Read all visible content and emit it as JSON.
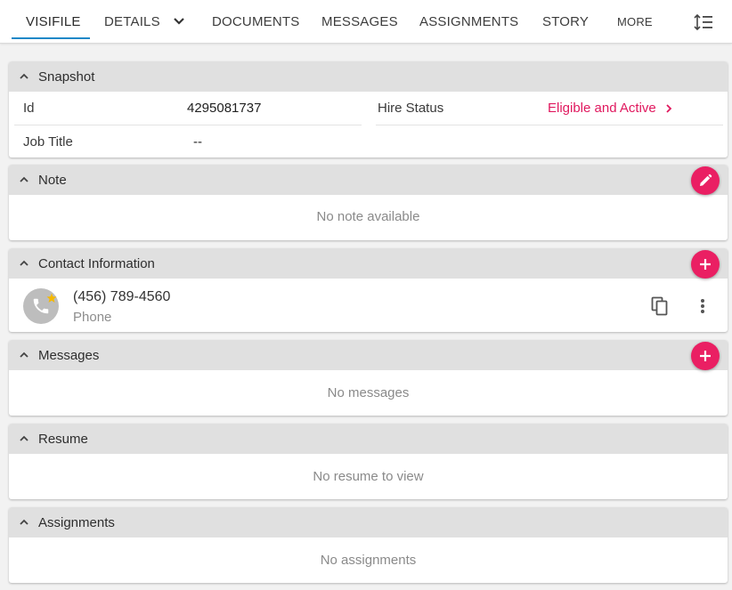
{
  "nav": {
    "tabs": [
      {
        "label": "VISIFILE"
      },
      {
        "label": "DETAILS"
      },
      {
        "label": "DOCUMENTS"
      },
      {
        "label": "MESSAGES"
      },
      {
        "label": "ASSIGNMENTS"
      },
      {
        "label": "STORY"
      },
      {
        "label": "MORE"
      }
    ],
    "active_tab": "VISIFILE",
    "sort_icon": "line-height-sort-icon"
  },
  "sections": {
    "snapshot": {
      "title": "Snapshot",
      "fields": {
        "id_label": "Id",
        "id_value": "4295081737",
        "hire_status_label": "Hire Status",
        "hire_status_value": "Eligible and Active",
        "job_title_label": "Job Title",
        "job_title_value": "--"
      }
    },
    "note": {
      "title": "Note",
      "empty": "No note available",
      "action_icon": "pencil-icon"
    },
    "contact": {
      "title": "Contact Information",
      "action_icon": "plus-icon",
      "items": [
        {
          "value": "(456) 789-4560",
          "type": "Phone",
          "icon": "phone-icon",
          "primary": true
        }
      ]
    },
    "messages": {
      "title": "Messages",
      "empty": "No messages",
      "action_icon": "plus-icon"
    },
    "resume": {
      "title": "Resume",
      "empty": "No resume to view"
    },
    "assignments": {
      "title": "Assignments",
      "empty": "No assignments"
    }
  },
  "colors": {
    "accent": "#ea1f63",
    "link": "#e0185e",
    "tab_underline": "#1e88c7",
    "header_bg": "#e0e0e0",
    "page_bg": "#f2f2f2"
  }
}
